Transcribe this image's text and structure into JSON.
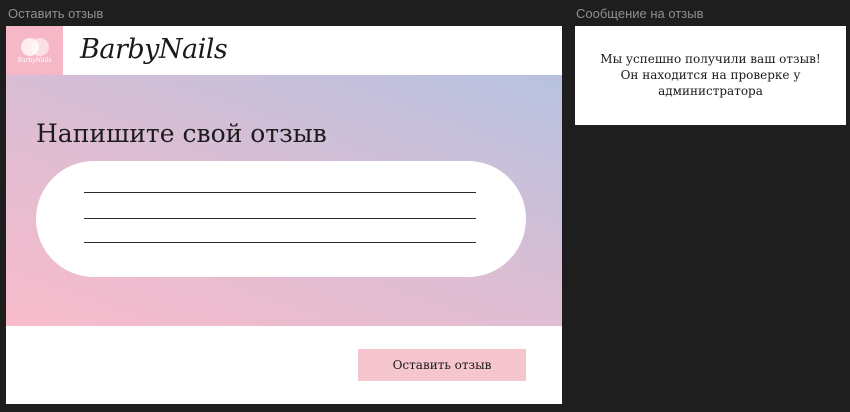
{
  "frames": {
    "left_label": "Оставить отзыв",
    "right_label": "Сообщение на отзыв"
  },
  "header": {
    "logo_small_text": "BarbyNails",
    "brand": "BarbyNails"
  },
  "main": {
    "title": "Напишите свой отзыв",
    "review_input_lines": 3
  },
  "footer": {
    "submit_label": "Оставить отзыв"
  },
  "message": {
    "line1": "Мы успешно получили ваш отзыв!",
    "line2": "Он находится на проверке у",
    "line3": "администратора"
  },
  "colors": {
    "canvas_background": "#1e1e1e",
    "logo_background": "#f6b8c6",
    "button_background": "#f6c6cf",
    "gradient_pink": "#f8bccb",
    "gradient_blue": "#b6c2e0"
  }
}
